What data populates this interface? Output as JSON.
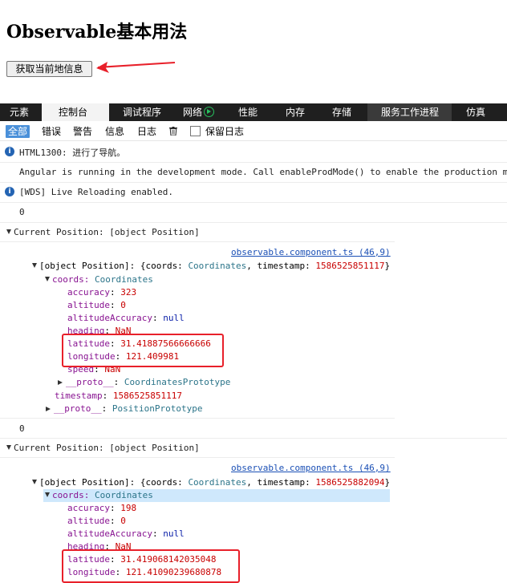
{
  "page": {
    "title": "Observable基本用法",
    "button_label": "获取当前地信息"
  },
  "devtools": {
    "tabs": [
      "元素",
      "控制台",
      "调试程序",
      "网络",
      "性能",
      "内存",
      "存储",
      "服务工作进程",
      "仿真"
    ],
    "active_tab": "控制台",
    "filters": [
      "全部",
      "错误",
      "警告",
      "信息",
      "日志"
    ],
    "active_filter": "全部",
    "preserve_log_label": "保留日志",
    "preserve_log_checked": false
  },
  "console": {
    "msg_nav": "HTML1300: 进行了导航。",
    "msg_angular": "Angular is running in the development mode. Call enableProdMode() to enable the production m",
    "msg_wds": "[WDS] Live Reloading enabled.",
    "zero": "0",
    "entries": [
      {
        "header": "Current Position: [object Position]",
        "source": "observable.component.ts (46,9)",
        "object_prefix": "[object Position]: {coords: ",
        "coords_type": "Coordinates",
        "object_mid": ", timestamp: ",
        "object_ts": "1586525851117",
        "object_suffix": "}",
        "coords_label": "coords: ",
        "props": [
          {
            "key": "accuracy",
            "value": "323",
            "kind": "num"
          },
          {
            "key": "altitude",
            "value": "0",
            "kind": "num"
          },
          {
            "key": "altitudeAccuracy",
            "value": "null",
            "kind": "kw"
          },
          {
            "key": "heading",
            "value": "NaN",
            "kind": "num"
          },
          {
            "key": "latitude",
            "value": "31.41887566666666",
            "kind": "num"
          },
          {
            "key": "longitude",
            "value": "121.409981",
            "kind": "num"
          },
          {
            "key": "speed",
            "value": "NaN",
            "kind": "num"
          }
        ],
        "proto_inner": "CoordinatesPrototype",
        "timestamp_label": "timestamp",
        "timestamp": "1586525851117",
        "proto_outer": "PositionPrototype"
      },
      {
        "header": "Current Position: [object Position]",
        "source": "observable.component.ts (46,9)",
        "object_prefix": "[object Position]: {coords: ",
        "coords_type": "Coordinates",
        "object_mid": ", timestamp: ",
        "object_ts": "1586525882094",
        "object_suffix": "}",
        "coords_label": "coords: ",
        "props": [
          {
            "key": "accuracy",
            "value": "198",
            "kind": "num"
          },
          {
            "key": "altitude",
            "value": "0",
            "kind": "num"
          },
          {
            "key": "altitudeAccuracy",
            "value": "null",
            "kind": "kw"
          },
          {
            "key": "heading",
            "value": "NaN",
            "kind": "num"
          },
          {
            "key": "latitude",
            "value": "31.419068142035048",
            "kind": "num"
          },
          {
            "key": "longitude",
            "value": "121.41090239680878",
            "kind": "num"
          }
        ]
      }
    ]
  },
  "proto_label": "__proto__",
  "colors": {
    "highlight_box": "#e8202a",
    "tabbar_bg": "#1f1f1f",
    "filter_selected": "#4a90d9",
    "selection_bg": "#cfe8fc"
  }
}
